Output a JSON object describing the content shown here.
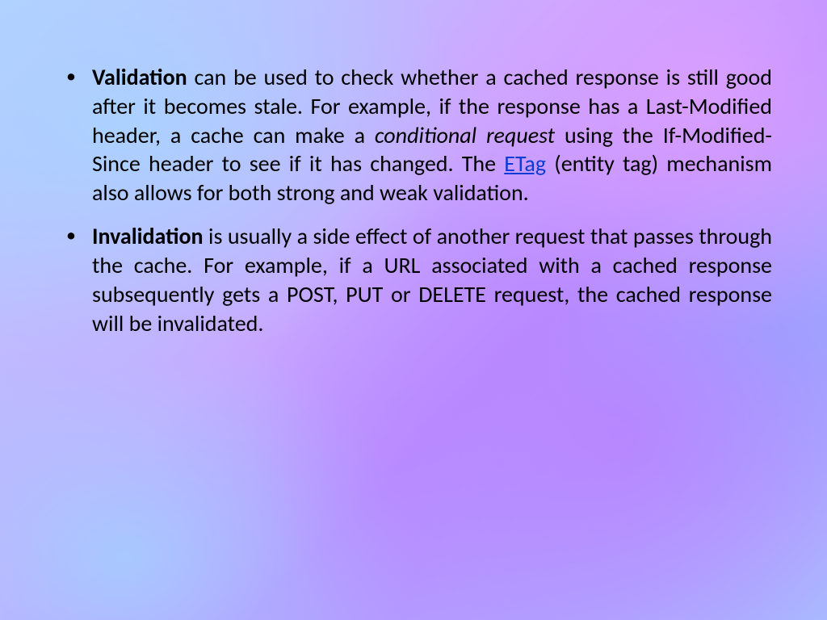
{
  "bullets": [
    {
      "term": "Validation",
      "parts": {
        "p1": " can be used to check whether a cached response is still good after it becomes stale. For example, if the response has a Last-Modified header, a cache can make a ",
        "italic": "conditional request",
        "p2": " using the If-Modified-Since header to see if it has changed. The ",
        "link": "ETag",
        "p3": " (entity tag) mechanism also allows for both strong and weak validation."
      }
    },
    {
      "term": "Invalidation",
      "parts": {
        "p1": " is usually a side effect of another request that passes through the cache. For example, if a URL associated with a cached response subsequently gets a POST, PUT or DELETE request, the cached response will be invalidated."
      }
    }
  ]
}
